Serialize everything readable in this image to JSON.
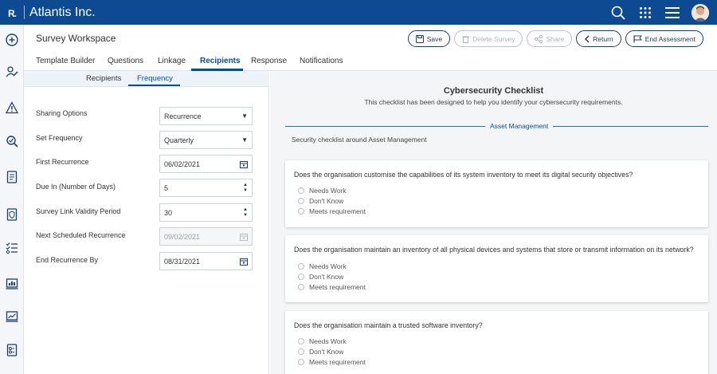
{
  "app": {
    "logo": "R",
    "title": "Atlantis Inc."
  },
  "topbar_icons": [
    "search-icon",
    "apps-grid-icon",
    "hamburger-menu-icon",
    "user-avatar"
  ],
  "sidebar_icons": [
    "add-circle-icon",
    "edit-user-icon",
    "warning-icon",
    "search-analysis-icon",
    "document-icon",
    "shield-document-icon",
    "checklist-icon",
    "report-icon",
    "trend-chart-icon",
    "survey-icon"
  ],
  "header": {
    "title": "Survey Workspace"
  },
  "actions": {
    "save": "Save",
    "delete": "Delete Survey",
    "share": "Share",
    "return": "Return",
    "end": "End Assessment"
  },
  "tabs": [
    "Template Builder",
    "Questions",
    "Linkage",
    "Recipients",
    "Response",
    "Notifications"
  ],
  "active_tab": "Recipients",
  "subtabs": [
    "Recipients",
    "Frequency"
  ],
  "active_subtab": "Frequency",
  "form": {
    "sharing_label": "Sharing Options",
    "sharing_value": "Recurrence",
    "freq_label": "Set Frequency",
    "freq_value": "Quarterly",
    "first_label": "First Recurrence",
    "first_value": "06/02/2021",
    "due_label": "Due In (Number of Days)",
    "due_value": "5",
    "validity_label": "Survey Link Validity Period",
    "validity_value": "30",
    "next_label": "Next Scheduled Recurrence",
    "next_value": "09/02/2021",
    "end_label": "End Recurrence By",
    "end_value": "08/31/2021"
  },
  "checklist": {
    "title": "Cybersecurity Checklist",
    "subtitle": "This checklist has been designed to help you identify your cybersecurity requirements.",
    "section": "Asset Management",
    "section_desc": "Security checklist around Asset Management",
    "options": [
      "Needs Work",
      "Don't Know",
      "Meets requirement"
    ],
    "questions": [
      "Does the organisation customise the capabilities of its system inventory to meet its digital security objectives?",
      "Does the organisation maintain an inventory of all physical devices and systems that store or transmit information on its network?",
      "Does the organisation maintain a trusted software inventory?"
    ]
  },
  "colors": {
    "brand": "#0d4a92",
    "border": "#1e3d6b"
  }
}
